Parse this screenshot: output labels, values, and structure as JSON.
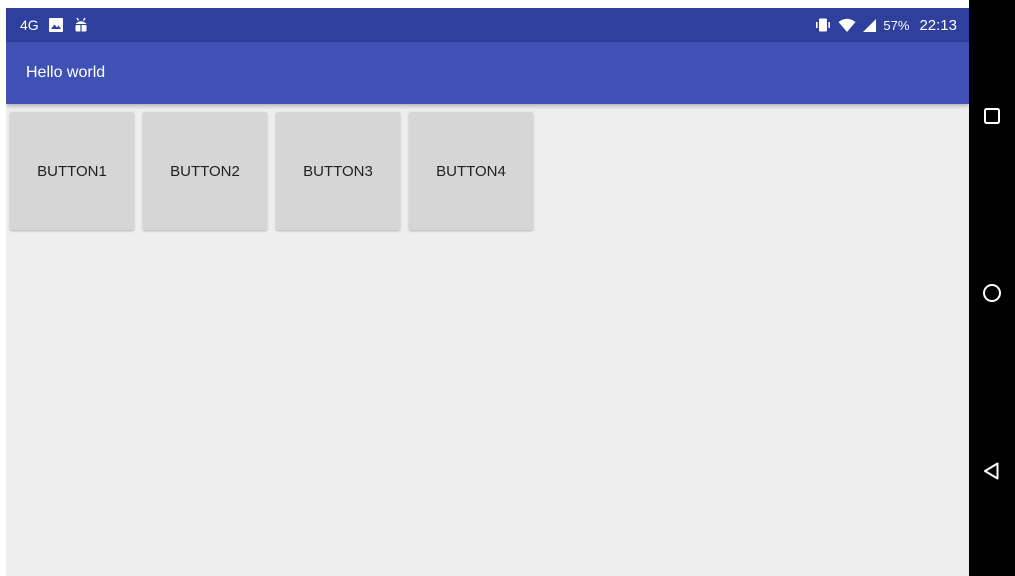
{
  "status_bar": {
    "network": "4G",
    "battery": "57%",
    "time": "22:13",
    "left_icons": [
      "image-icon",
      "android-debug-icon"
    ],
    "right_icons": [
      "vibrate-icon",
      "wifi-icon",
      "signal-icon"
    ]
  },
  "app_bar": {
    "title": "Hello world"
  },
  "buttons": [
    {
      "label": "BUTTON1"
    },
    {
      "label": "BUTTON2"
    },
    {
      "label": "BUTTON3"
    },
    {
      "label": "BUTTON4"
    }
  ],
  "nav_bar": {
    "icons": [
      "recents-square-icon",
      "home-circle-icon",
      "back-triangle-icon"
    ]
  },
  "colors": {
    "status_bar": "#2e3f9d",
    "app_bar": "#3f51b5",
    "background": "#eeeeee",
    "button": "#d6d6d6",
    "nav_bar": "#000000"
  }
}
